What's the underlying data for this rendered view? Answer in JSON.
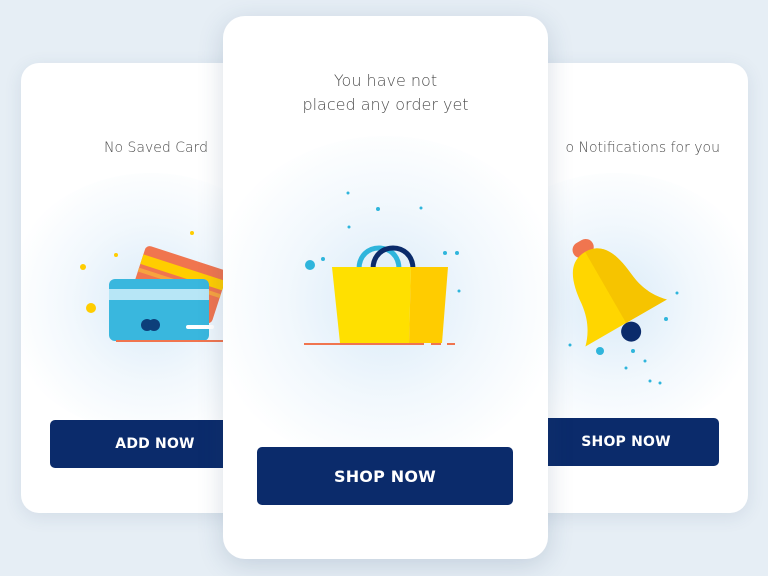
{
  "cards": {
    "left": {
      "message": "No Saved Card",
      "button_label": "ADD NOW",
      "illustration_icon": "credit-card-icon"
    },
    "center": {
      "message_line1": "You have not",
      "message_line2": "placed any order yet",
      "button_label": "SHOP NOW",
      "illustration_icon": "shopping-bag-icon"
    },
    "right": {
      "message": "o Notifications for you",
      "button_label": "SHOP NOW",
      "illustration_icon": "bell-icon"
    }
  },
  "colors": {
    "background": "#e6eef5",
    "button": "#0b2b6b",
    "accent_yellow": "#ffd600",
    "accent_blue": "#2fb5dc",
    "accent_orange": "#f0754f"
  }
}
